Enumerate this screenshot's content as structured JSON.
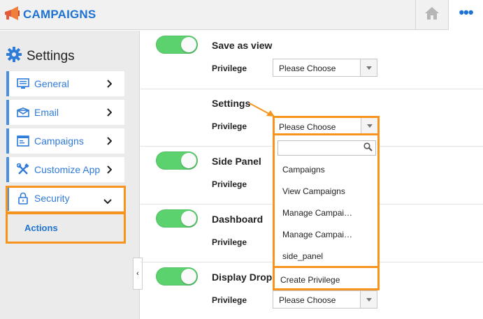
{
  "header": {
    "app_title": "CAMPAIGNS",
    "logo_icon": "megaphone-icon",
    "home_icon": "home-icon",
    "more_icon": "more-dots-icon",
    "more_glyph": "•••",
    "brand_color": "#1e73d2"
  },
  "sidebar": {
    "title": "Settings",
    "title_icon": "gear-icon",
    "items": [
      {
        "label": "General",
        "icon": "monitor-icon"
      },
      {
        "label": "Email",
        "icon": "envelope-icon"
      },
      {
        "label": "Campaigns",
        "icon": "window-icon"
      },
      {
        "label": "Customize App",
        "icon": "tools-icon"
      },
      {
        "label": "Security",
        "icon": "lock-icon",
        "expanded": true
      }
    ],
    "sub_item": "Actions",
    "collapse_glyph": "‹",
    "highlight_color": "#f7941d"
  },
  "main": {
    "sections": [
      {
        "title": "Save as view",
        "toggle_on": true,
        "privilege_label": "Privilege",
        "select_value": "Please Choose"
      },
      {
        "title": "Settings",
        "toggle_on": false,
        "privilege_label": "Privilege",
        "select_value": "Please Choose"
      },
      {
        "title": "Side Panel",
        "toggle_on": true,
        "privilege_label": "Privilege"
      },
      {
        "title": "Dashboard",
        "toggle_on": true,
        "privilege_label": "Privilege"
      },
      {
        "title": "Display Drop",
        "toggle_on": true,
        "privilege_label": "Privilege",
        "select_value": "Please Choose"
      }
    ],
    "toggle_color": "#5cd26f"
  },
  "dropdown": {
    "search_value": "",
    "search_icon": "search-icon",
    "options": [
      "Campaigns",
      "View Campaigns",
      "Manage Campai…",
      "Manage Campai…",
      "side_panel"
    ],
    "create_label": "Create Privilege"
  }
}
